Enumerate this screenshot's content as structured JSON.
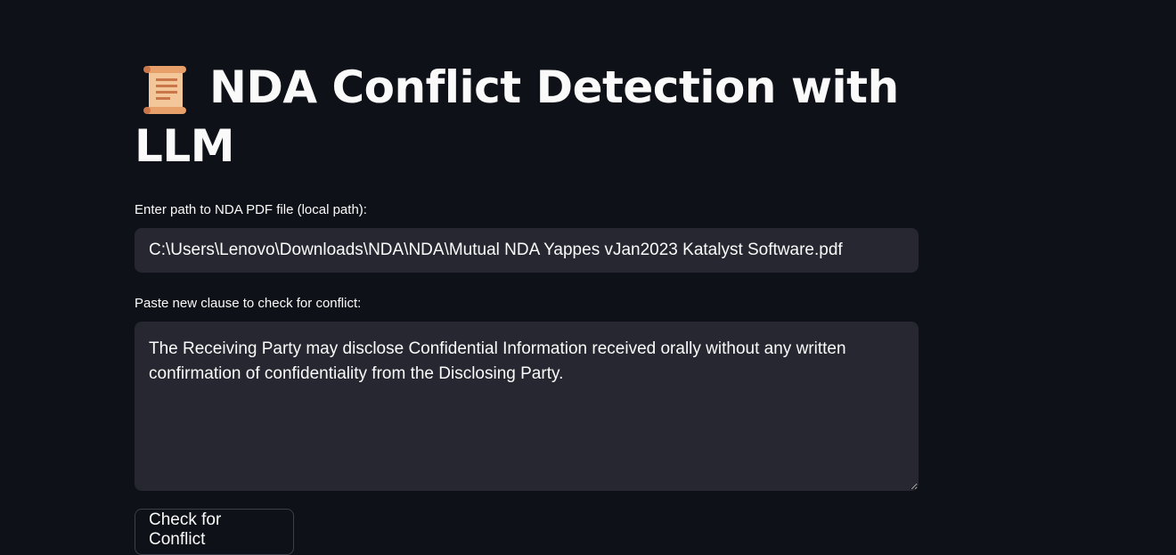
{
  "page": {
    "title": "NDA Conflict Detection with LLM",
    "title_icon": "scroll-icon"
  },
  "path_input": {
    "label": "Enter path to NDA PDF file (local path):",
    "value": "C:\\Users\\Lenovo\\Downloads\\NDA\\NDA\\Mutual NDA Yappes vJan2023 Katalyst Software.pdf"
  },
  "clause_input": {
    "label": "Paste new clause to check for conflict:",
    "value": "The Receiving Party may disclose Confidential Information received orally without any written confirmation of confidentiality from the Disclosing Party."
  },
  "actions": {
    "check_label": "Check for Conflict"
  },
  "colors": {
    "background": "#0e1117",
    "input_background": "#262730",
    "text": "#fafafa",
    "button_border": "#3d4048"
  }
}
